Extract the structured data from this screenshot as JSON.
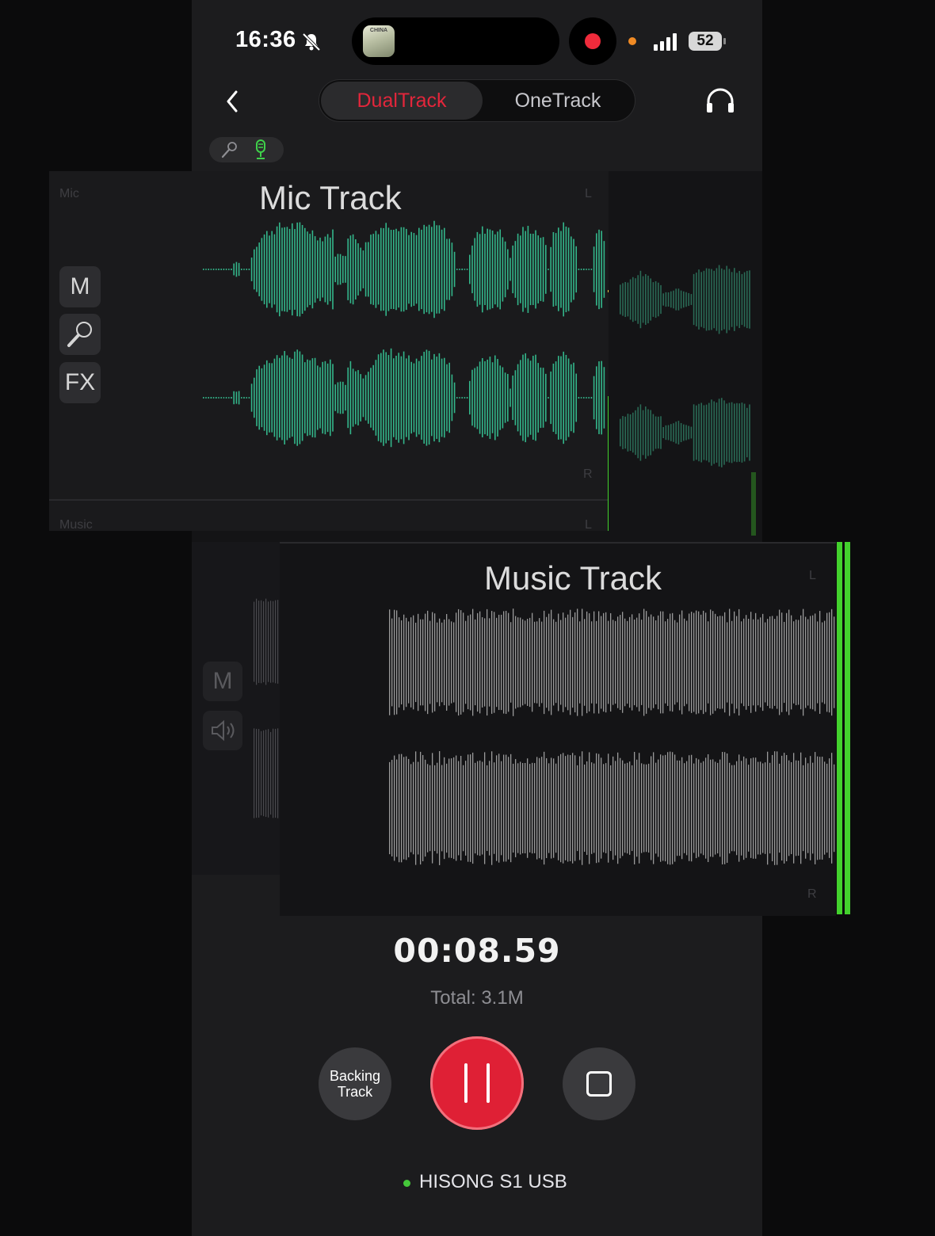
{
  "status_bar": {
    "time": "16:36",
    "album_text": "CHINA",
    "battery": "52"
  },
  "nav": {
    "tabs": [
      {
        "label": "DualTrack",
        "active": true
      },
      {
        "label": "OneTrack",
        "active": false
      }
    ]
  },
  "mic_track": {
    "section_label": "Mic",
    "title": "Mic Track",
    "left_label": "L",
    "right_label": "R",
    "buttons": {
      "mute": "M",
      "fx": "FX"
    }
  },
  "music_track": {
    "section_label": "Music",
    "title": "Music Track",
    "left_label": "L",
    "right_label": "R",
    "buttons": {
      "mute": "M"
    }
  },
  "recording": {
    "elapsed": "00:08.59",
    "total": "Total: 3.1M"
  },
  "controls": {
    "backing_track": "Backing\nTrack"
  },
  "device": {
    "name": "HISONG S1 USB",
    "status_color": "#45c83a"
  },
  "colors": {
    "accent": "#e3263b",
    "mic_wave": "#33b68a",
    "music_wave": "#9a9a9a",
    "meter": "#43d12d"
  }
}
